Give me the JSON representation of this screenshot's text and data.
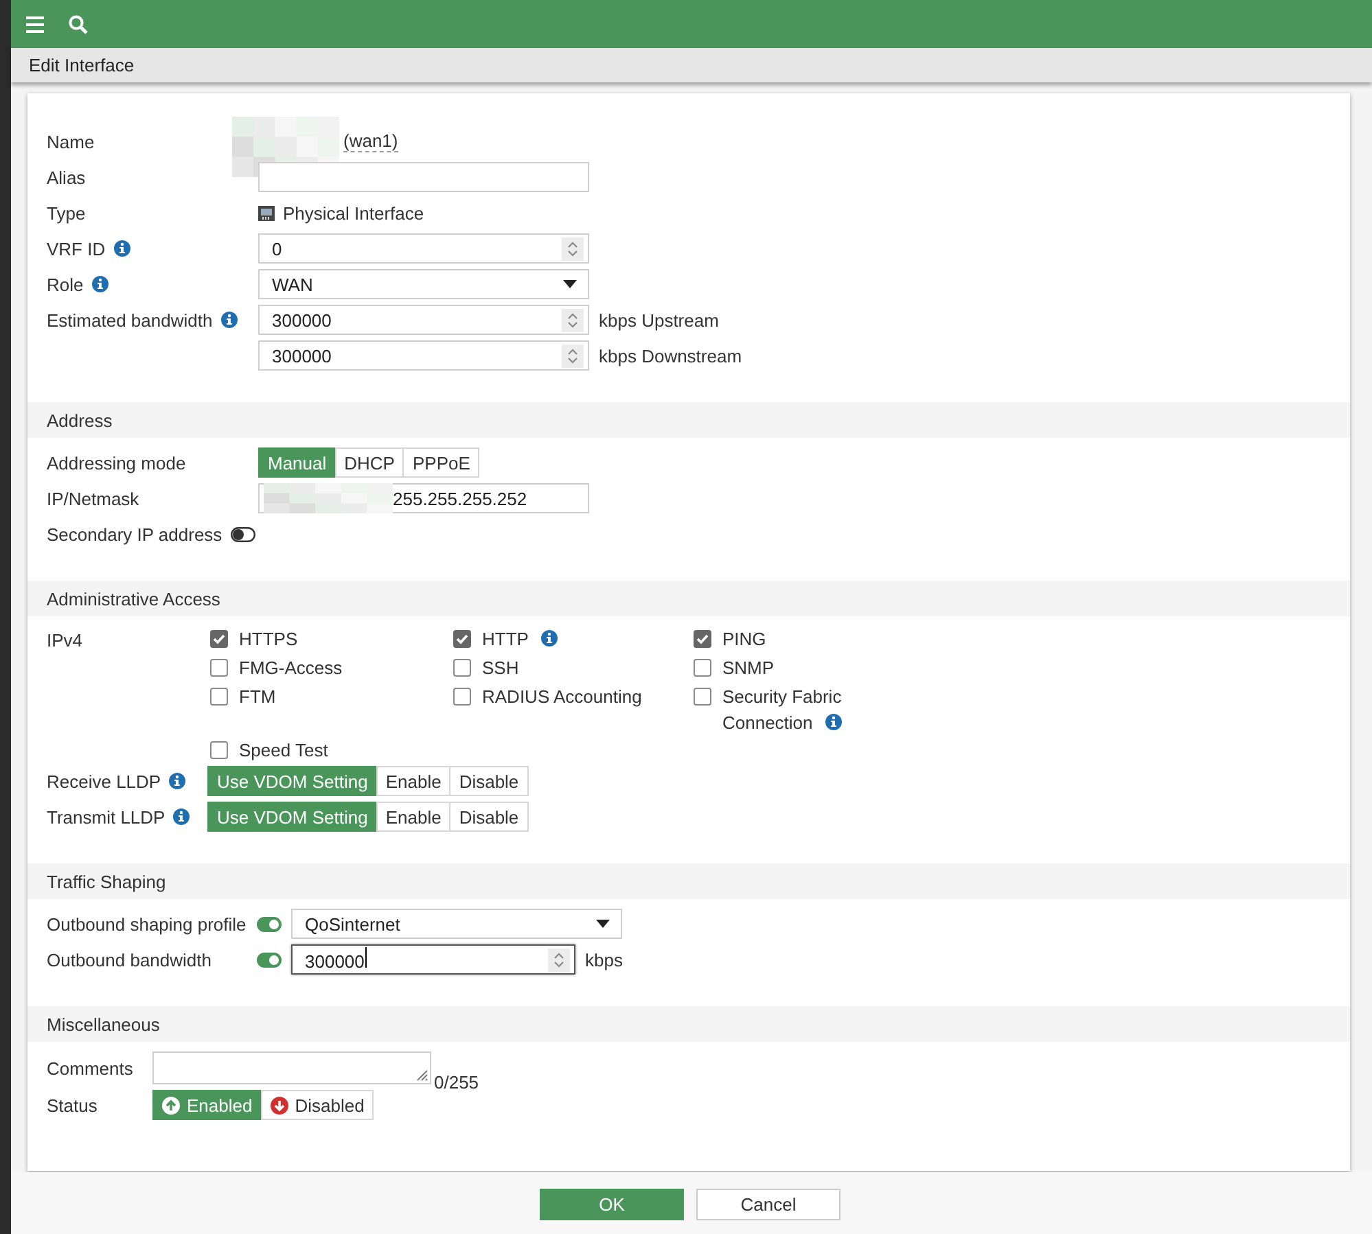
{
  "page_title": "Edit Interface",
  "top_rows": [
    {
      "kind": "name",
      "label": "Name",
      "value": "(wan1)",
      "redacted": true
    },
    {
      "kind": "text",
      "label": "Alias"
    },
    {
      "kind": "type",
      "label": "Type",
      "value": "Physical Interface"
    },
    {
      "kind": "number",
      "label": "VRF ID",
      "info": true,
      "value": "0"
    },
    {
      "kind": "select",
      "label": "Role",
      "info": true,
      "value": "WAN"
    },
    {
      "kind": "number",
      "label": "Estimated bandwidth",
      "info": true,
      "value": "300000",
      "unit": "kbps Upstream"
    },
    {
      "kind": "number",
      "value": "300000",
      "unit": "kbps Downstream"
    }
  ],
  "sections": [
    {
      "title": "Address",
      "rows": [
        {
          "kind": "segmented",
          "label": "Addressing mode",
          "options": [
            {
              "label": "Manual",
              "selected": true
            },
            {
              "label": "DHCP",
              "selected": false
            },
            {
              "label": "PPPoE",
              "selected": false
            }
          ]
        },
        {
          "kind": "text",
          "label": "IP/Netmask",
          "redacted": true,
          "value": "255.255.255.252"
        },
        {
          "kind": "toggle",
          "label": "Secondary IP address",
          "on": false
        }
      ]
    },
    {
      "title": "Administrative Access",
      "rows": [
        {
          "kind": "checks",
          "label": "IPv4",
          "check_rows": [
            [
              {
                "label": "HTTPS",
                "checked": true
              },
              {
                "label": "HTTP",
                "checked": true,
                "info": true
              },
              {
                "label": "PING",
                "checked": true
              }
            ],
            [
              {
                "label": "FMG-Access",
                "checked": false
              },
              {
                "label": "SSH",
                "checked": false
              },
              {
                "label": "SNMP",
                "checked": false
              }
            ],
            [
              {
                "label": "FTM",
                "checked": false
              },
              {
                "label": "RADIUS Accounting",
                "checked": false
              },
              {
                "label": "Security Fabric Connection",
                "checked": false,
                "info": true
              }
            ],
            [
              {
                "label": "Speed Test",
                "checked": false
              }
            ]
          ]
        },
        {
          "kind": "segmented",
          "label": "Receive LLDP",
          "info": true,
          "options": [
            {
              "label": "Use VDOM Setting",
              "selected": true
            },
            {
              "label": "Enable",
              "selected": false
            },
            {
              "label": "Disable",
              "selected": false
            }
          ]
        },
        {
          "kind": "segmented",
          "label": "Transmit LLDP",
          "info": true,
          "options": [
            {
              "label": "Use VDOM Setting",
              "selected": true
            },
            {
              "label": "Enable",
              "selected": false
            },
            {
              "label": "Disable",
              "selected": false
            }
          ]
        }
      ]
    },
    {
      "title": "Traffic Shaping",
      "rows": [
        {
          "kind": "select",
          "label": "Outbound shaping profile",
          "toggle_on": true,
          "value": "QoSinternet"
        },
        {
          "kind": "number",
          "label": "Outbound bandwidth",
          "toggle_on": true,
          "value": "300000",
          "unit": "kbps",
          "focused": true
        }
      ]
    },
    {
      "title": "Miscellaneous",
      "rows": [
        {
          "kind": "textarea",
          "label": "Comments",
          "counter": "0/255"
        },
        {
          "kind": "status",
          "label": "Status",
          "options": [
            {
              "label": "Enabled",
              "selected": true
            },
            {
              "label": "Disabled",
              "selected": false
            }
          ]
        }
      ]
    }
  ],
  "buttons": [
    {
      "label": "OK",
      "primary": true
    },
    {
      "label": "Cancel",
      "primary": false
    }
  ]
}
